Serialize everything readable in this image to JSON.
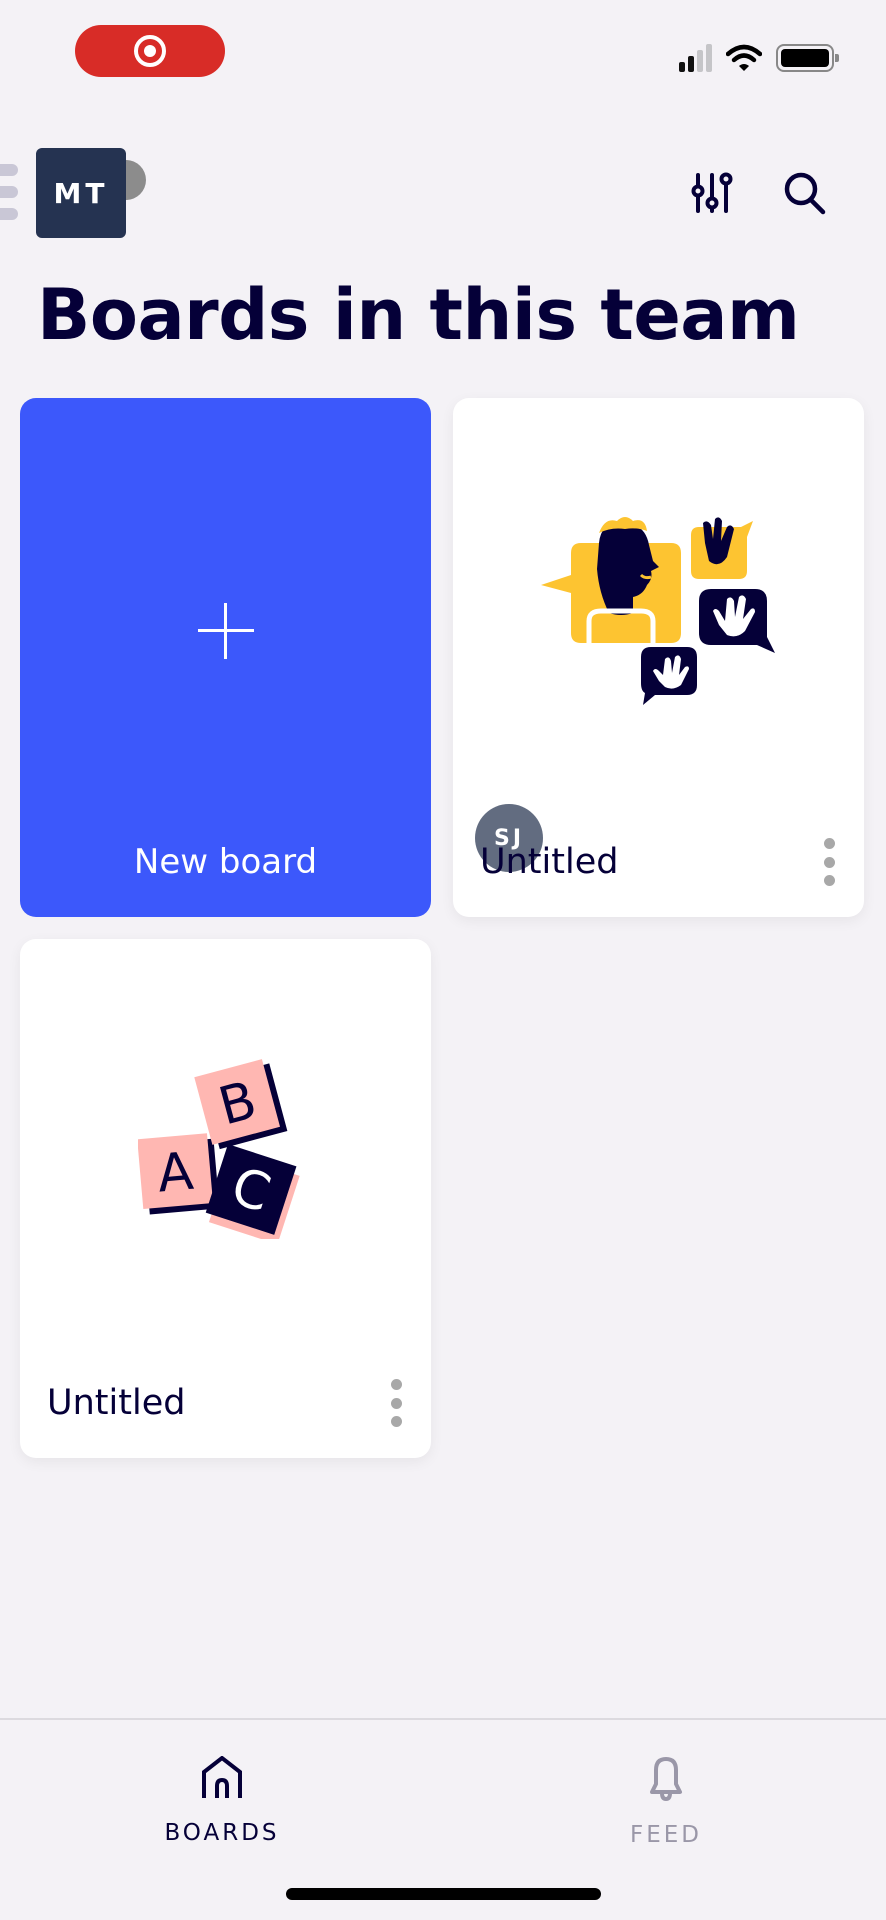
{
  "status_bar": {
    "recording_icon": "screen-recording-icon",
    "signal_icon": "cellular-signal-icon",
    "wifi_icon": "wifi-icon",
    "battery_icon": "battery-icon"
  },
  "header": {
    "menu_icon": "hamburger-menu-icon",
    "team_avatar_initials": "MT",
    "filter_icon": "sliders-filter-icon",
    "search_icon": "search-icon"
  },
  "page_title": "Boards in this team",
  "colors": {
    "accent": "#3c58fb",
    "title_text": "#050038",
    "background": "#f4f2f6",
    "recording_red": "#d82c27",
    "illustration_yellow": "#fdc431",
    "illustration_navy": "#050038",
    "illustration_pink": "#ffb7b2"
  },
  "boards": {
    "new_board": {
      "icon": "plus-icon",
      "label": "New board"
    },
    "items": [
      {
        "title": "Untitled",
        "owner_initials": "SJ",
        "thumbnail": "waving-hands-chat-illustration",
        "menu_icon": "more-vertical-icon"
      },
      {
        "title": "Untitled",
        "thumbnail": "abc-blocks-illustration",
        "menu_icon": "more-vertical-icon"
      }
    ]
  },
  "bottom_nav": {
    "items": [
      {
        "label": "BOARDS",
        "icon": "home-icon",
        "active": true
      },
      {
        "label": "FEED",
        "icon": "bell-icon",
        "active": false
      }
    ]
  }
}
